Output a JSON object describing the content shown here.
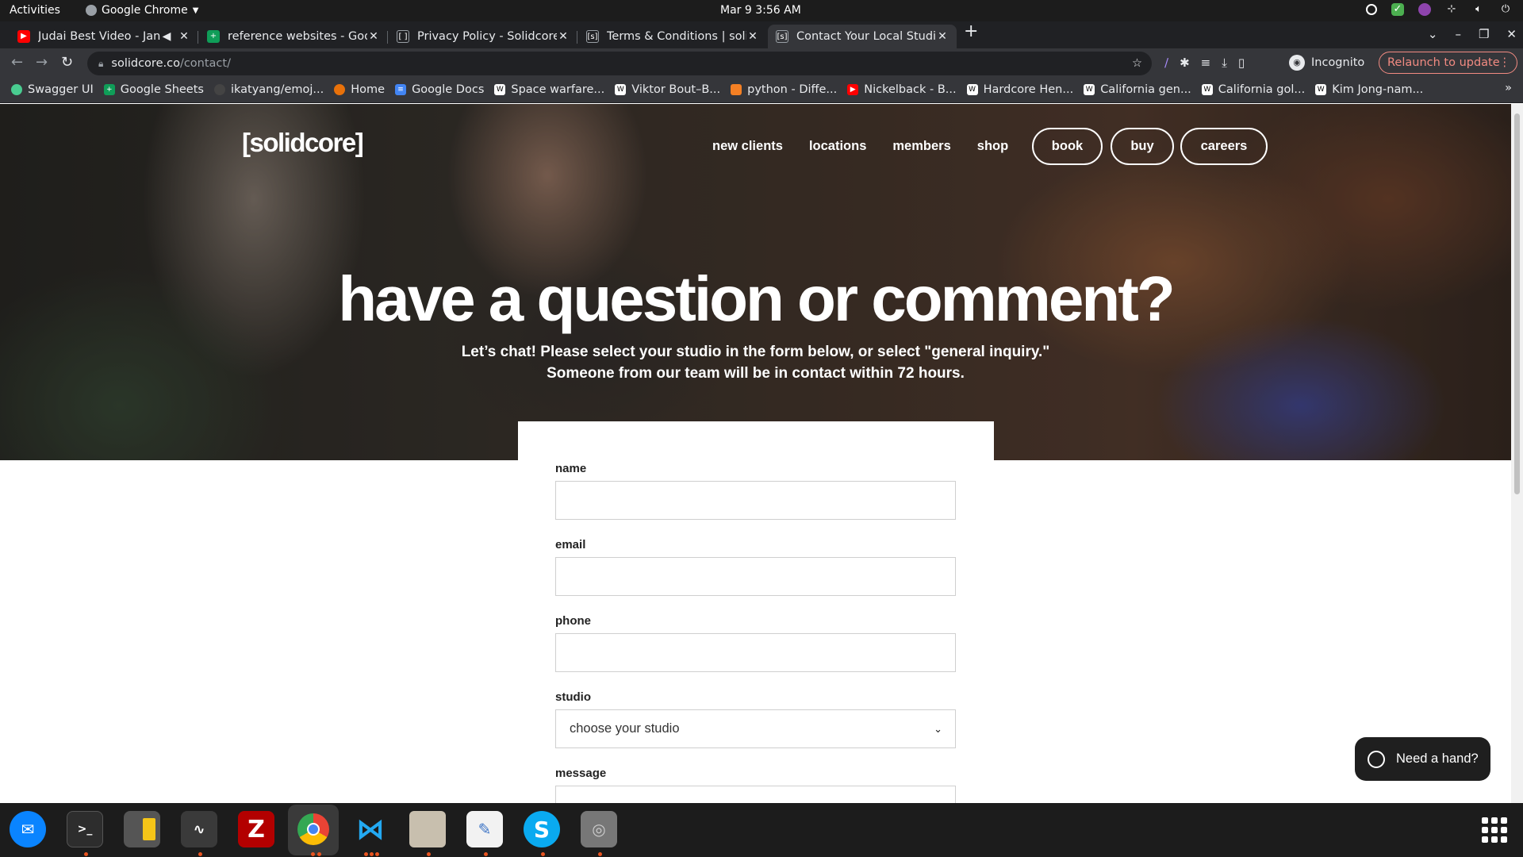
{
  "system": {
    "activities": "Activities",
    "app_name": "Google Chrome",
    "clock": "Mar 9  3:56 AM"
  },
  "tabs": [
    {
      "title": "Judai Best Video - Jan",
      "favicon_color": "#ff0000"
    },
    {
      "title": "reference websites - Goog",
      "favicon_color": "#0f9d58"
    },
    {
      "title": "Privacy Policy - Solidcore",
      "favicon_color": "#202124"
    },
    {
      "title": "Terms & Conditions | solid",
      "favicon_color": "#202124"
    },
    {
      "title": "Contact Your Local Studio",
      "favicon_color": "#202124"
    }
  ],
  "toolbar": {
    "url_domain": "solidcore.co",
    "url_path": "/contact/",
    "incognito": "Incognito",
    "relaunch": "Relaunch to update"
  },
  "bookmarks": [
    {
      "label": "Swagger UI",
      "color": "#49cc90"
    },
    {
      "label": "Google Sheets",
      "color": "#0f9d58"
    },
    {
      "label": "ikatyang/emoj...",
      "color": "#444444"
    },
    {
      "label": "Home",
      "color": "#e8710a"
    },
    {
      "label": "Google Docs",
      "color": "#4285f4"
    },
    {
      "label": "Space warfare...",
      "color": "#ffffff"
    },
    {
      "label": "Viktor Bout–B...",
      "color": "#ffffff"
    },
    {
      "label": "python - Diffe...",
      "color": "#f48024"
    },
    {
      "label": "Nickelback - B...",
      "color": "#ff0000"
    },
    {
      "label": "Hardcore Hen...",
      "color": "#ffffff"
    },
    {
      "label": "California gen...",
      "color": "#ffffff"
    },
    {
      "label": "California gol...",
      "color": "#ffffff"
    },
    {
      "label": "Kim Jong-nam...",
      "color": "#ffffff"
    }
  ],
  "site": {
    "logo": "[solidcore]",
    "nav": [
      "new clients",
      "locations",
      "members",
      "shop"
    ],
    "pills": [
      "book",
      "buy",
      "careers"
    ],
    "headline": "have a question or comment?",
    "subline1": "Let’s chat! Please select your studio in the form below, or select \"general inquiry.\"",
    "subline2": "Someone from our team will be in contact within 72 hours."
  },
  "form": {
    "name_label": "name",
    "email_label": "email",
    "phone_label": "phone",
    "studio_label": "studio",
    "studio_value": "choose your studio",
    "message_label": "message"
  },
  "help_widget": {
    "label": "Need a hand?"
  },
  "dock_apps": [
    "thunderbird",
    "terminal",
    "calculator",
    "system-monitor",
    "filezilla",
    "chrome",
    "vscode",
    "files",
    "text-editor",
    "skype",
    "disks"
  ]
}
